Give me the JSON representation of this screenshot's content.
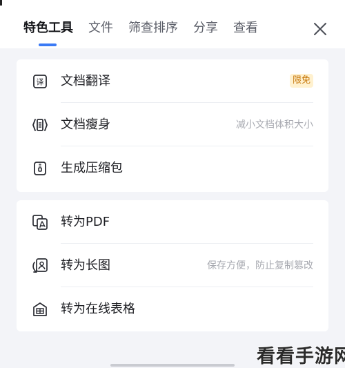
{
  "tabs": [
    {
      "label": "特色工具",
      "active": true
    },
    {
      "label": "文件",
      "active": false
    },
    {
      "label": "筛查排序",
      "active": false
    },
    {
      "label": "分享",
      "active": false
    },
    {
      "label": "查看",
      "active": false
    }
  ],
  "close": {
    "icon": "close-icon"
  },
  "group1": [
    {
      "label": "文档翻译",
      "icon": "translate-icon",
      "badge": "限免"
    },
    {
      "label": "文档瘦身",
      "icon": "slim-document-icon",
      "hint": "减小文档体积大小"
    },
    {
      "label": "生成压缩包",
      "icon": "zip-icon"
    }
  ],
  "group2": [
    {
      "label": "转为PDF",
      "icon": "pdf-convert-icon"
    },
    {
      "label": "转为长图",
      "icon": "long-image-icon",
      "hint": "保存方便，防止复制篡改"
    },
    {
      "label": "转为在线表格",
      "icon": "online-sheet-icon"
    }
  ],
  "watermark": "看看手游网",
  "colors": {
    "accent": "#3a7af5",
    "badge_bg": "#fff1cf",
    "badge_text": "#c7780c",
    "hint": "#a7a9b0",
    "background": "#f3f4f8"
  }
}
